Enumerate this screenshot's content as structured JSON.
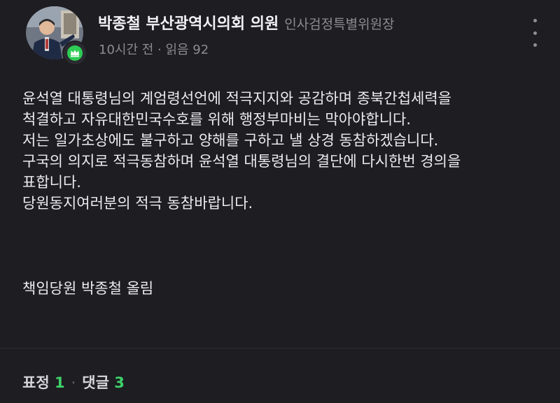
{
  "post": {
    "author": {
      "name": "박종철 부산광역시의회 의원",
      "title": "인사검정특별위원장"
    },
    "meta": "10시간 전 · 읽음 92",
    "body_lines": [
      "윤석열 대통령님의 계엄령선언에 적극지지와 공감하며 종북간첩세력을",
      "척결하고 자유대한민국수호를 위해 행정부마비는 막아야합니다.",
      "저는 일가초상에도 불구하고 양해를 구하고 낼 상경 동참하겠습니다.",
      "구국의 의지로 적극동참하며 윤석열 대통령님의 결단에 다시한번 경의을",
      "표합니다.",
      "당원동지여러분의 적극 동참바랍니다."
    ],
    "signature": "책임당원 박종철 올림"
  },
  "footer": {
    "reactions_label": "표정",
    "reactions_count": "1",
    "comments_label": "댓글",
    "comments_count": "3"
  },
  "colors": {
    "background": "#1d1d22",
    "count_accent": "#3fd16a",
    "badge_green": "#2ecc55"
  },
  "icons": {
    "badge": "crown-icon",
    "more": "more-vertical-icon"
  }
}
